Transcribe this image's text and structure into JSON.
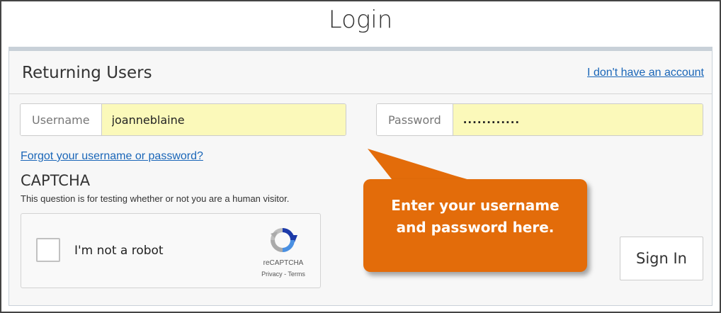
{
  "page": {
    "title": "Login"
  },
  "panel": {
    "heading": "Returning Users",
    "no_account_link": "I don't have an account"
  },
  "username": {
    "label": "Username",
    "value": "joanneblaine"
  },
  "password": {
    "label": "Password",
    "value": "............"
  },
  "forgot_link": "Forgot your username or password?",
  "captcha": {
    "heading": "CAPTCHA",
    "help": "This question is for testing whether or not you are a human visitor.",
    "checkbox_label": "I'm not a robot",
    "brand": "reCAPTCHA",
    "terms": "Privacy - Terms",
    "icon": "recaptcha-logo-icon"
  },
  "callout": {
    "line1": "Enter your username",
    "line2": "and password here.",
    "color": "#e36c0a"
  },
  "signin_label": "Sign In",
  "colors": {
    "input_highlight": "#fbf9ba",
    "link": "#1a66b8"
  }
}
